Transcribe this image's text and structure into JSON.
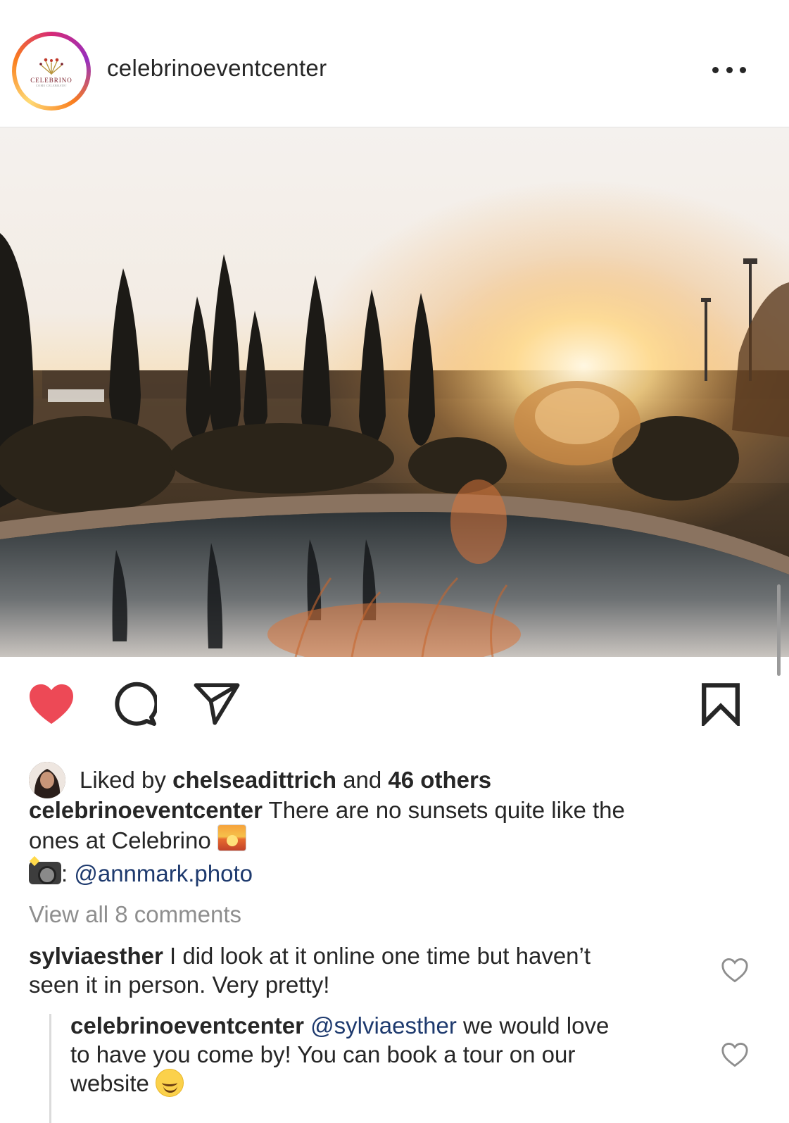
{
  "post": {
    "username": "celebrinoeventcenter",
    "avatar_logo_text": "CELEBRINO",
    "avatar_logo_subtext": "COME CELEBRATE!",
    "more_icon": "more-horizontal-icon"
  },
  "actions": {
    "like_icon": "heart-filled-icon",
    "like_color": "#ed4956",
    "comment_icon": "comment-icon",
    "share_icon": "paper-plane-icon",
    "save_icon": "bookmark-icon"
  },
  "likes": {
    "prefix": "Liked by",
    "user": "chelseadittrich",
    "connector": "and",
    "others": "46 others"
  },
  "caption": {
    "username": "celebrinoeventcenter",
    "text_line1": "There are no sunsets quite like the",
    "text_line2": "ones at Celebrino",
    "credit_separator": ":",
    "credit_handle": "@annmark.photo"
  },
  "view_all_comments": "View all 8 comments",
  "comments": [
    {
      "username": "sylviaesther",
      "text_line1": "I did look at it online one time but haven’t",
      "text_line2": "seen it in person. Very pretty!"
    },
    {
      "username": "celebrinoeventcenter",
      "mention": "@sylviaesther",
      "text_line1": "we would love",
      "text_line2": "to have you come by! You can book a tour on our",
      "text_line3": "website"
    }
  ],
  "colors": {
    "link": "#1e3a6e",
    "muted": "#8e8e8e",
    "text": "#262626"
  }
}
